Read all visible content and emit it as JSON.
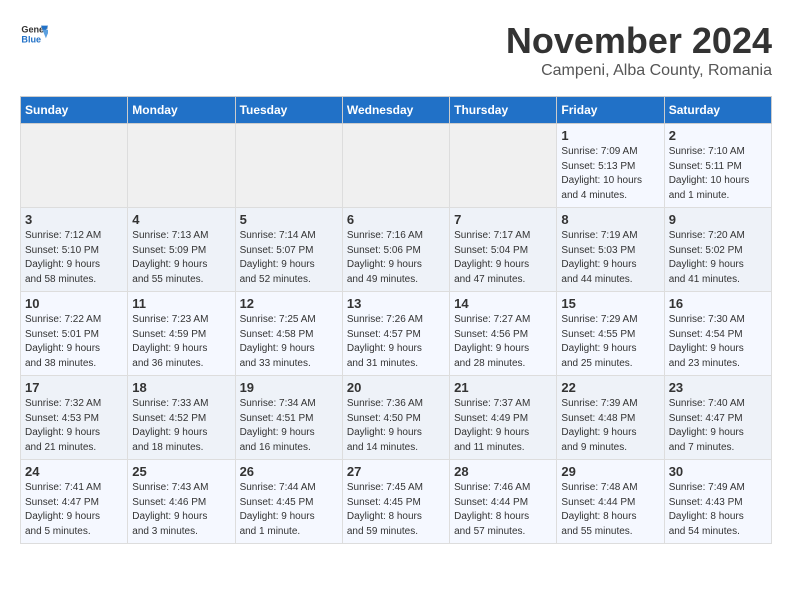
{
  "header": {
    "logo_line1": "General",
    "logo_line2": "Blue",
    "month_title": "November 2024",
    "subtitle": "Campeni, Alba County, Romania"
  },
  "weekdays": [
    "Sunday",
    "Monday",
    "Tuesday",
    "Wednesday",
    "Thursday",
    "Friday",
    "Saturday"
  ],
  "weeks": [
    [
      {
        "day": "",
        "info": ""
      },
      {
        "day": "",
        "info": ""
      },
      {
        "day": "",
        "info": ""
      },
      {
        "day": "",
        "info": ""
      },
      {
        "day": "",
        "info": ""
      },
      {
        "day": "1",
        "info": "Sunrise: 7:09 AM\nSunset: 5:13 PM\nDaylight: 10 hours\nand 4 minutes."
      },
      {
        "day": "2",
        "info": "Sunrise: 7:10 AM\nSunset: 5:11 PM\nDaylight: 10 hours\nand 1 minute."
      }
    ],
    [
      {
        "day": "3",
        "info": "Sunrise: 7:12 AM\nSunset: 5:10 PM\nDaylight: 9 hours\nand 58 minutes."
      },
      {
        "day": "4",
        "info": "Sunrise: 7:13 AM\nSunset: 5:09 PM\nDaylight: 9 hours\nand 55 minutes."
      },
      {
        "day": "5",
        "info": "Sunrise: 7:14 AM\nSunset: 5:07 PM\nDaylight: 9 hours\nand 52 minutes."
      },
      {
        "day": "6",
        "info": "Sunrise: 7:16 AM\nSunset: 5:06 PM\nDaylight: 9 hours\nand 49 minutes."
      },
      {
        "day": "7",
        "info": "Sunrise: 7:17 AM\nSunset: 5:04 PM\nDaylight: 9 hours\nand 47 minutes."
      },
      {
        "day": "8",
        "info": "Sunrise: 7:19 AM\nSunset: 5:03 PM\nDaylight: 9 hours\nand 44 minutes."
      },
      {
        "day": "9",
        "info": "Sunrise: 7:20 AM\nSunset: 5:02 PM\nDaylight: 9 hours\nand 41 minutes."
      }
    ],
    [
      {
        "day": "10",
        "info": "Sunrise: 7:22 AM\nSunset: 5:01 PM\nDaylight: 9 hours\nand 38 minutes."
      },
      {
        "day": "11",
        "info": "Sunrise: 7:23 AM\nSunset: 4:59 PM\nDaylight: 9 hours\nand 36 minutes."
      },
      {
        "day": "12",
        "info": "Sunrise: 7:25 AM\nSunset: 4:58 PM\nDaylight: 9 hours\nand 33 minutes."
      },
      {
        "day": "13",
        "info": "Sunrise: 7:26 AM\nSunset: 4:57 PM\nDaylight: 9 hours\nand 31 minutes."
      },
      {
        "day": "14",
        "info": "Sunrise: 7:27 AM\nSunset: 4:56 PM\nDaylight: 9 hours\nand 28 minutes."
      },
      {
        "day": "15",
        "info": "Sunrise: 7:29 AM\nSunset: 4:55 PM\nDaylight: 9 hours\nand 25 minutes."
      },
      {
        "day": "16",
        "info": "Sunrise: 7:30 AM\nSunset: 4:54 PM\nDaylight: 9 hours\nand 23 minutes."
      }
    ],
    [
      {
        "day": "17",
        "info": "Sunrise: 7:32 AM\nSunset: 4:53 PM\nDaylight: 9 hours\nand 21 minutes."
      },
      {
        "day": "18",
        "info": "Sunrise: 7:33 AM\nSunset: 4:52 PM\nDaylight: 9 hours\nand 18 minutes."
      },
      {
        "day": "19",
        "info": "Sunrise: 7:34 AM\nSunset: 4:51 PM\nDaylight: 9 hours\nand 16 minutes."
      },
      {
        "day": "20",
        "info": "Sunrise: 7:36 AM\nSunset: 4:50 PM\nDaylight: 9 hours\nand 14 minutes."
      },
      {
        "day": "21",
        "info": "Sunrise: 7:37 AM\nSunset: 4:49 PM\nDaylight: 9 hours\nand 11 minutes."
      },
      {
        "day": "22",
        "info": "Sunrise: 7:39 AM\nSunset: 4:48 PM\nDaylight: 9 hours\nand 9 minutes."
      },
      {
        "day": "23",
        "info": "Sunrise: 7:40 AM\nSunset: 4:47 PM\nDaylight: 9 hours\nand 7 minutes."
      }
    ],
    [
      {
        "day": "24",
        "info": "Sunrise: 7:41 AM\nSunset: 4:47 PM\nDaylight: 9 hours\nand 5 minutes."
      },
      {
        "day": "25",
        "info": "Sunrise: 7:43 AM\nSunset: 4:46 PM\nDaylight: 9 hours\nand 3 minutes."
      },
      {
        "day": "26",
        "info": "Sunrise: 7:44 AM\nSunset: 4:45 PM\nDaylight: 9 hours\nand 1 minute."
      },
      {
        "day": "27",
        "info": "Sunrise: 7:45 AM\nSunset: 4:45 PM\nDaylight: 8 hours\nand 59 minutes."
      },
      {
        "day": "28",
        "info": "Sunrise: 7:46 AM\nSunset: 4:44 PM\nDaylight: 8 hours\nand 57 minutes."
      },
      {
        "day": "29",
        "info": "Sunrise: 7:48 AM\nSunset: 4:44 PM\nDaylight: 8 hours\nand 55 minutes."
      },
      {
        "day": "30",
        "info": "Sunrise: 7:49 AM\nSunset: 4:43 PM\nDaylight: 8 hours\nand 54 minutes."
      }
    ]
  ]
}
